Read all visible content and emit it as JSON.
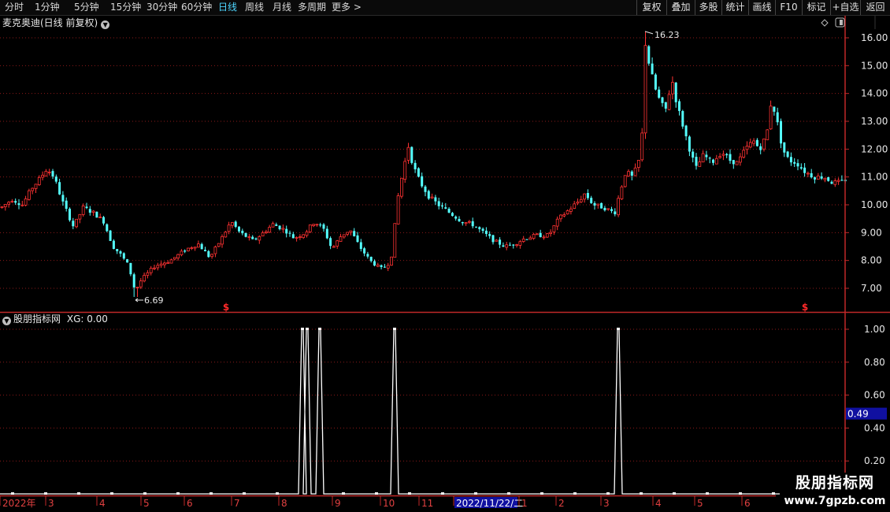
{
  "toolbar": {
    "left_items": [
      {
        "label": "分时",
        "active": false
      },
      {
        "label": "1分钟",
        "active": false
      },
      {
        "label": "5分钟",
        "active": false
      },
      {
        "label": "15分钟",
        "active": false
      },
      {
        "label": "30分钟",
        "active": false
      },
      {
        "label": "60分钟",
        "active": false
      },
      {
        "label": "日线",
        "active": true
      },
      {
        "label": "周线",
        "active": false
      },
      {
        "label": "月线",
        "active": false
      },
      {
        "label": "多周期",
        "active": false
      },
      {
        "label": "更多 >",
        "active": false
      }
    ],
    "right_items": [
      "复权",
      "叠加",
      "多股",
      "统计",
      "画线",
      "F10",
      "标记",
      "+自选",
      "返回"
    ]
  },
  "main_chart": {
    "title": "麦克奥迪(日线 前复权)",
    "icons": [
      "chevron-down-icon",
      "diamond-icon",
      "panel-toggle-icon"
    ],
    "y_ticks": [
      "16.00",
      "15.00",
      "14.00",
      "13.00",
      "12.00",
      "11.00",
      "10.00",
      "9.00",
      "8.00",
      "7.00"
    ],
    "high_label": "16.23",
    "low_label": "6.69",
    "signal_marker": "$",
    "colors": {
      "up": "#ff3232",
      "down": "#54ffff",
      "grid": "#8b1a1a",
      "axis": "#c02828"
    }
  },
  "indicator": {
    "title": "股朋指标网",
    "value_label": "XG: 0.00",
    "y_ticks": [
      "1.00",
      "0.80",
      "0.60",
      "0.40",
      "0.20"
    ],
    "cursor_value": "0.49",
    "cursor_color": "#1010a0"
  },
  "x_axis": {
    "labels": [
      "2022年",
      "3",
      "4",
      "5",
      "6",
      "7",
      "8",
      "9",
      "10",
      "11",
      "2022/11/22/二",
      "1",
      "2",
      "3",
      "4",
      "5",
      "6"
    ],
    "highlight_label": "2022/11/22/二"
  },
  "watermark": {
    "line1": "股朋指标网",
    "line2": "www.7gpzb.com"
  },
  "chart_data": {
    "type": "candlestick",
    "price_range": [
      6.69,
      16.23
    ],
    "price_axis_range": [
      6.6,
      16.4
    ],
    "key_closes": [
      {
        "label": "start",
        "value": 10.0
      },
      {
        "label": "early high",
        "value": 11.4
      },
      {
        "label": "low",
        "value": 6.69
      },
      {
        "label": "first rally peak",
        "value": 12.3
      },
      {
        "label": "mid trough",
        "value": 8.4
      },
      {
        "label": "high",
        "value": 16.23
      },
      {
        "label": "end",
        "value": 10.9
      }
    ],
    "indicator_series": {
      "name": "XG",
      "range": [
        0,
        1
      ],
      "signals": [
        {
          "period": "8",
          "value": 1.0
        },
        {
          "period": "8",
          "value": 1.0
        },
        {
          "period": "8",
          "value": 1.0
        },
        {
          "period": "10",
          "value": 1.0
        },
        {
          "period": "3",
          "value": 1.0
        }
      ],
      "baseline": 0.0
    }
  }
}
